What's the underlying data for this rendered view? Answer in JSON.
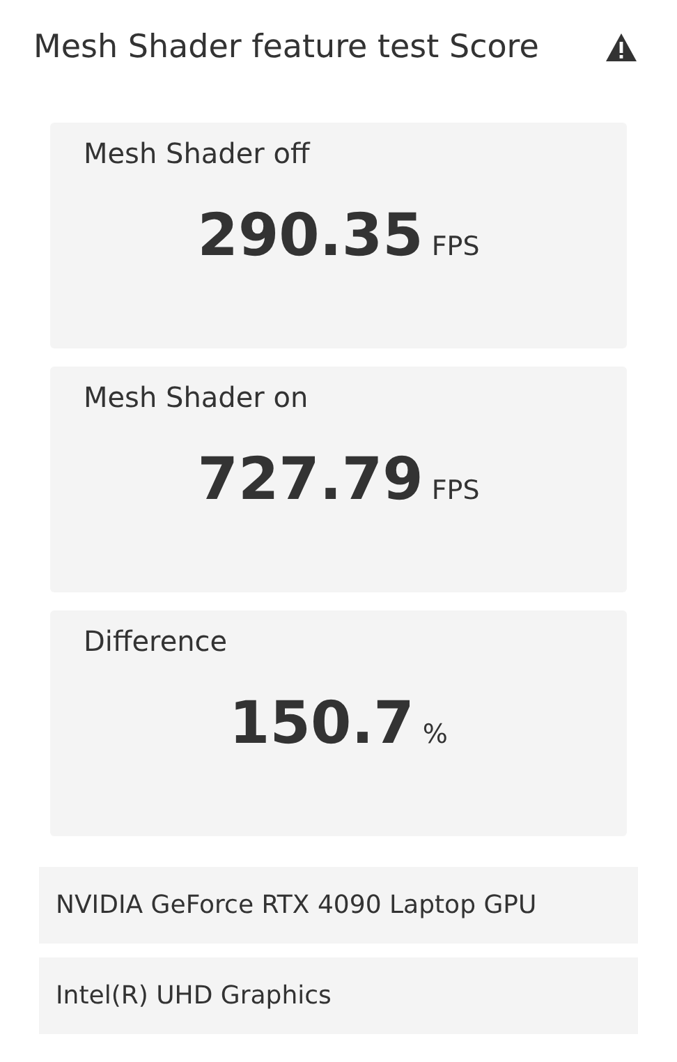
{
  "title": "Mesh Shader feature test Score",
  "results": [
    {
      "label": "Mesh Shader off",
      "value": "290.35",
      "unit": "FPS"
    },
    {
      "label": "Mesh Shader on",
      "value": "727.79",
      "unit": "FPS"
    },
    {
      "label": "Difference",
      "value": "150.7",
      "unit": "%"
    }
  ],
  "devices": [
    "NVIDIA GeForce RTX 4090 Laptop GPU",
    "Intel(R) UHD Graphics"
  ]
}
